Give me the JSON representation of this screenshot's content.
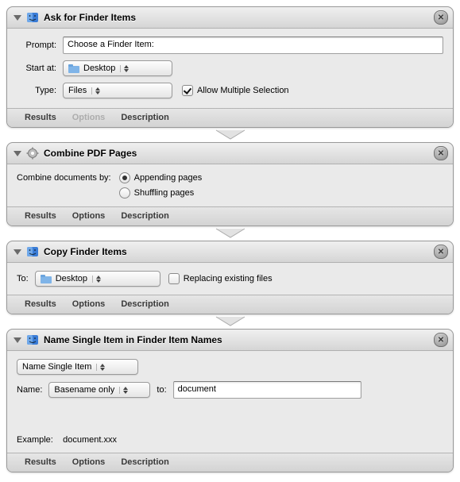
{
  "panels": {
    "ask": {
      "title": "Ask for Finder Items",
      "promptLabel": "Prompt:",
      "promptValue": "Choose a Finder Item:",
      "startAtLabel": "Start at:",
      "startAtValue": "Desktop",
      "typeLabel": "Type:",
      "typeValue": "Files",
      "allowMultiple": "Allow Multiple Selection",
      "tabs": {
        "results": "Results",
        "options": "Options",
        "description": "Description"
      }
    },
    "combine": {
      "title": "Combine PDF Pages",
      "byLabel": "Combine documents by:",
      "opt1": "Appending pages",
      "opt2": "Shuffling pages",
      "tabs": {
        "results": "Results",
        "options": "Options",
        "description": "Description"
      }
    },
    "copy": {
      "title": "Copy Finder Items",
      "toLabel": "To:",
      "toValue": "Desktop",
      "replace": "Replacing existing files",
      "tabs": {
        "results": "Results",
        "options": "Options",
        "description": "Description"
      }
    },
    "name": {
      "title": "Name Single Item in Finder Item Names",
      "modeValue": "Name Single Item",
      "nameLabel": "Name:",
      "partValue": "Basename only",
      "toLabel": "to:",
      "toValue": "document",
      "exampleLabel": "Example:",
      "exampleValue": "document.xxx",
      "tabs": {
        "results": "Results",
        "options": "Options",
        "description": "Description"
      }
    }
  }
}
